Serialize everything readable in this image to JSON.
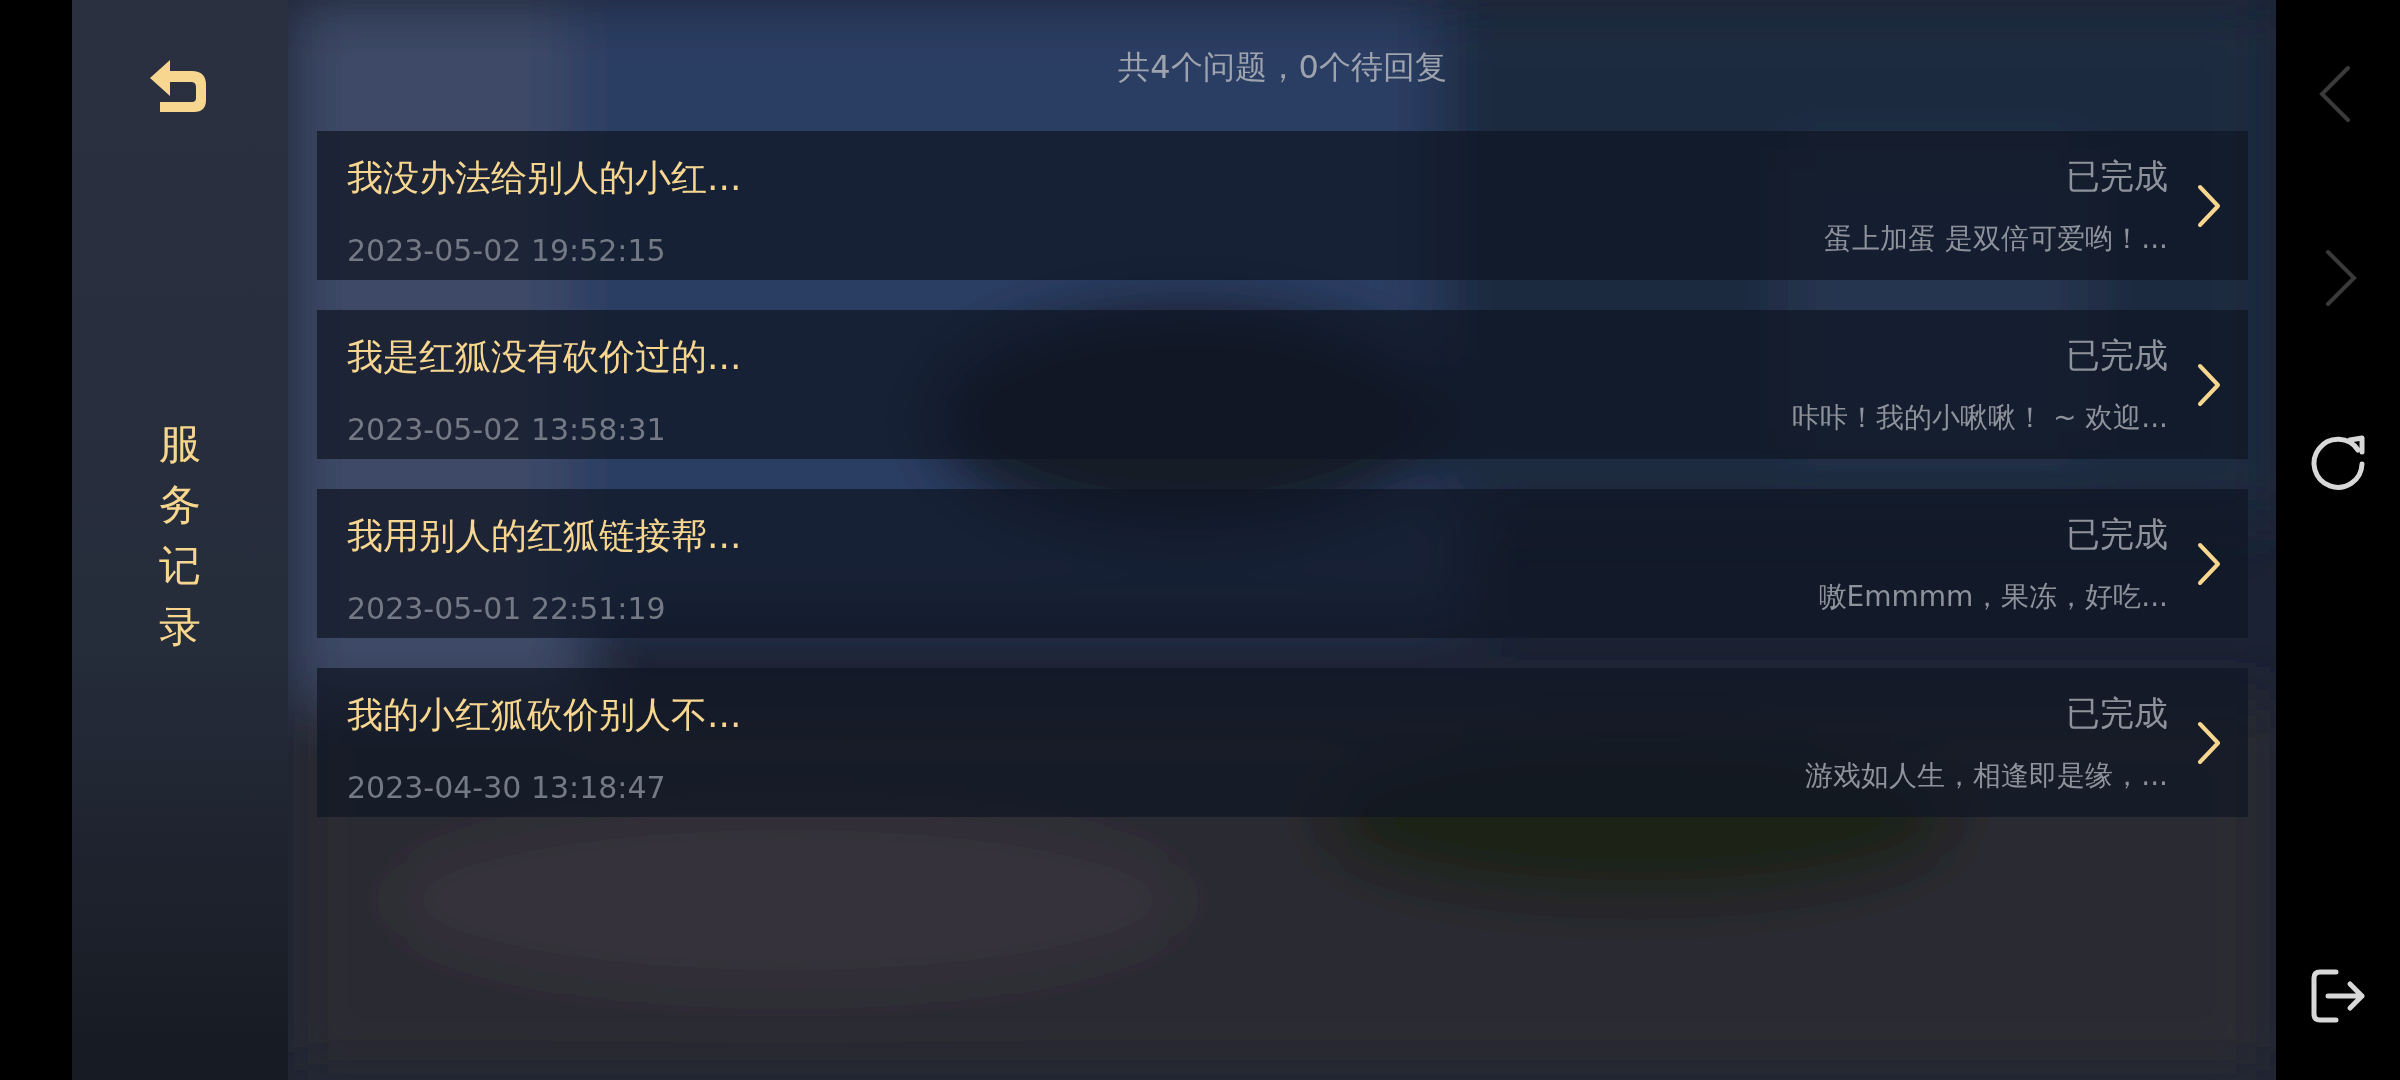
{
  "sidebar": {
    "title": "服务记录"
  },
  "summary": "共4个问题，0个待回复",
  "records": [
    {
      "title": "我没办法给别人的小红...",
      "time": "2023-05-02 19:52:15",
      "status": "已完成",
      "reply": "蛋上加蛋 是双倍可爱哟！..."
    },
    {
      "title": "我是红狐没有砍价过的...",
      "time": "2023-05-02 13:58:31",
      "status": "已完成",
      "reply": "咔咔！我的小啾啾！ ~ 欢迎..."
    },
    {
      "title": "我用别人的红狐链接帮...",
      "time": "2023-05-01 22:51:19",
      "status": "已完成",
      "reply": "嗷Emmmm，果冻，好吃..."
    },
    {
      "title": "我的小红狐砍价别人不...",
      "time": "2023-04-30 13:18:47",
      "status": "已完成",
      "reply": "游戏如人生，相逢即是缘，..."
    }
  ],
  "nav_buttons": [
    {
      "kind": "back",
      "disabled": true
    },
    {
      "kind": "forward",
      "disabled": true
    },
    {
      "kind": "refresh",
      "disabled": false
    },
    {
      "kind": "exit",
      "disabled": false
    }
  ]
}
